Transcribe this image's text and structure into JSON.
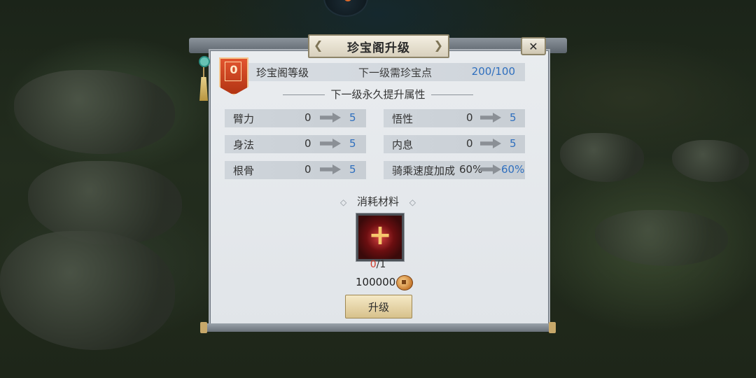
{
  "panel": {
    "title": "珍宝阁升级",
    "close_label": "✕"
  },
  "level": {
    "badge_value": "0",
    "label": "珍宝阁等级",
    "requirement_label": "下一级需珍宝点",
    "requirement_value": "200/100"
  },
  "bonus_section": {
    "title": "下一级永久提升属性",
    "stats": [
      {
        "name": "臂力",
        "current": "0",
        "next": "5"
      },
      {
        "name": "悟性",
        "current": "0",
        "next": "5"
      },
      {
        "name": "身法",
        "current": "0",
        "next": "5"
      },
      {
        "name": "内息",
        "current": "0",
        "next": "5"
      },
      {
        "name": "根骨",
        "current": "0",
        "next": "5"
      },
      {
        "name": "骑乘速度加成",
        "current": "60%",
        "next": "60%"
      }
    ]
  },
  "materials": {
    "title": "消耗材料",
    "item_icon": "plus-icon",
    "owned": "0",
    "required": "/1",
    "cost": "100000",
    "currency_icon": "copper-coin-icon"
  },
  "actions": {
    "upgrade_label": "升级"
  },
  "colors": {
    "accent_blue": "#2f6fbe",
    "warning_red": "#d33a2a",
    "badge_red": "#c63e1b"
  }
}
